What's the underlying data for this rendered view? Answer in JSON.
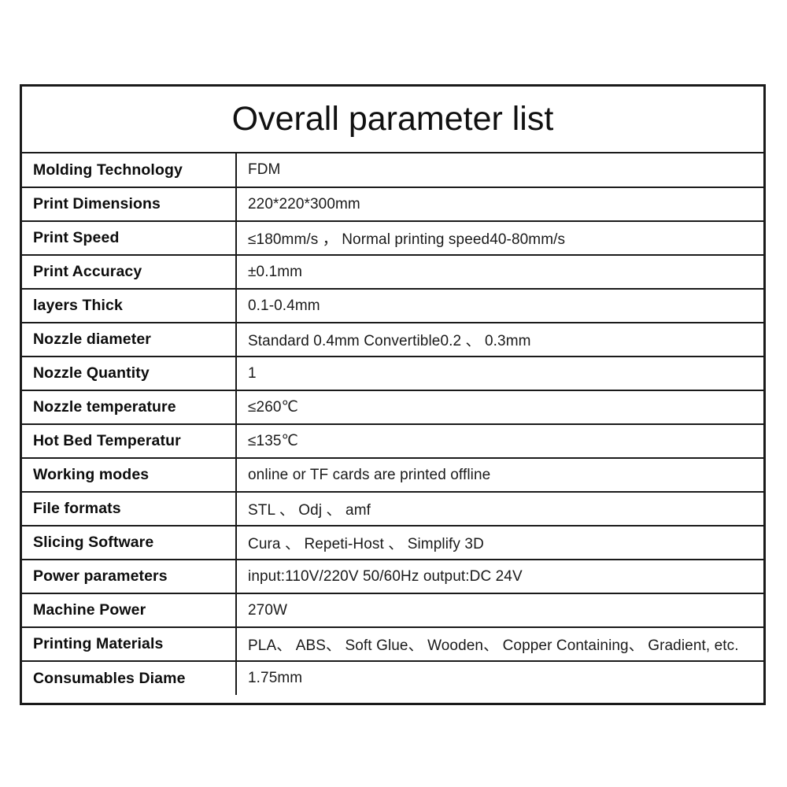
{
  "document": {
    "title": "Overall parameter list",
    "rows": [
      {
        "label": "Molding Technology",
        "value": "FDM"
      },
      {
        "label": "Print Dimensions",
        "value": "220*220*300mm"
      },
      {
        "label": "Print Speed",
        "value": "≤180mm/s ，      Normal printing speed40-80mm/s"
      },
      {
        "label": "Print Accuracy",
        "value": "±0.1mm"
      },
      {
        "label": "layers Thick",
        "value": "0.1-0.4mm"
      },
      {
        "label": "Nozzle diameter",
        "value": "Standard 0.4mm   Convertible0.2 、  0.3mm"
      },
      {
        "label": "Nozzle Quantity",
        "value": "1"
      },
      {
        "label": "Nozzle temperature",
        "value": "≤260℃"
      },
      {
        "label": "Hot Bed Temperatur",
        "value": "≤135℃"
      },
      {
        "label": "Working modes",
        "value": "online or TF cards are printed offline"
      },
      {
        "label": "File formats",
        "value": "STL 、 Odj 、 amf"
      },
      {
        "label": "Slicing Software",
        "value": "Cura 、  Repeti-Host 、   Simplify 3D"
      },
      {
        "label": "Power parameters",
        "value": " input:110V/220V    50/60Hz   output:DC 24V"
      },
      {
        "label": "Machine Power",
        "value": "270W"
      },
      {
        "label": "Printing Materials",
        "value": "PLA、 ABS、 Soft Glue、 Wooden、 Copper Containing、 Gradient, etc."
      },
      {
        "label": "Consumables Diame",
        "value": "1.75mm"
      }
    ]
  }
}
